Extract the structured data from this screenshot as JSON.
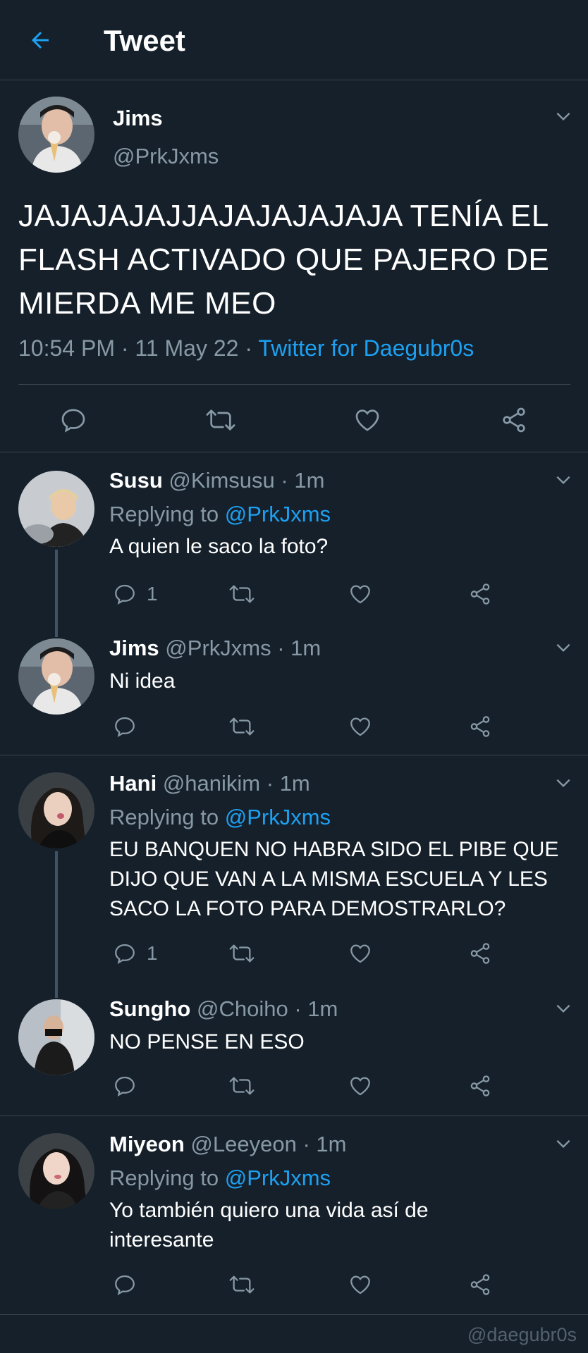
{
  "header": {
    "title": "Tweet",
    "back_icon": "arrow-left-icon"
  },
  "colors": {
    "background": "#15202b",
    "accent": "#1da1f2",
    "muted": "#8899a6",
    "divider": "#38444d"
  },
  "main_tweet": {
    "name": "Jims",
    "handle": "@PrkJxms",
    "text": "JAJAJAJAJJAJAJAJAJAJA TENÍA EL FLASH ACTIVADO QUE PAJERO DE MIERDA ME MEO",
    "time": "10:54 PM",
    "date": "11 May 22",
    "source": "Twitter for Daegubr0s",
    "sep": "·"
  },
  "replies": [
    {
      "name": "Susu",
      "handle": "@Kimsusu",
      "time": "1m",
      "replying_label": "Replying to",
      "replying_to": "@PrkJxms",
      "text": "A quien le saco la foto?",
      "reply_count": "1"
    },
    {
      "name": "Jims",
      "handle": "@PrkJxms",
      "time": "1m",
      "text": "Ni idea",
      "reply_count": ""
    },
    {
      "name": "Hani",
      "handle": "@hanikim",
      "time": "1m",
      "replying_label": "Replying to",
      "replying_to": "@PrkJxms",
      "text": "EU BANQUEN NO HABRA SIDO EL PIBE QUE DIJO QUE VAN A LA MISMA ESCUELA Y LES SACO LA FOTO PARA DEMOSTRARLO?",
      "reply_count": "1"
    },
    {
      "name": "Sungho",
      "handle": "@Choiho",
      "time": "1m",
      "text": "NO PENSE EN ESO",
      "reply_count": ""
    },
    {
      "name": "Miyeon",
      "handle": "@Leeyeon",
      "time": "1m",
      "replying_label": "Replying to",
      "replying_to": "@PrkJxms",
      "text": "Yo también quiero una vida así de interesante",
      "reply_count": ""
    }
  ],
  "watermark": "@daegubr0s"
}
